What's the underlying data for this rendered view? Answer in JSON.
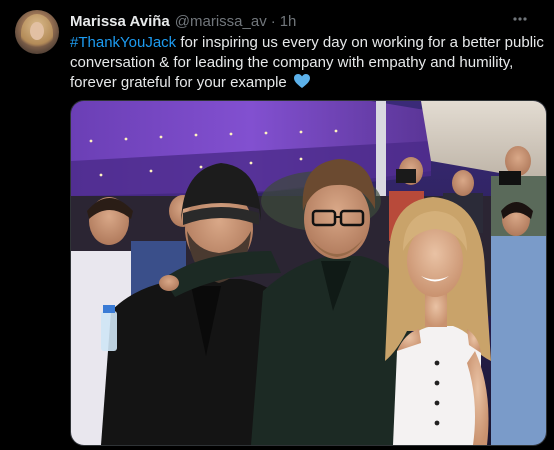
{
  "tweet": {
    "author_name": "Marissa Aviña",
    "author_handle": "@marissa_av",
    "separator": "·",
    "timestamp": "1h",
    "hashtag": "#ThankYouJack",
    "text": " for inspiring us every day on working for a better public conversation & for leading the company with empathy and humility, forever grateful for your example",
    "emoji": "blue-heart-icon",
    "more_icon": "more-options-icon",
    "media": {
      "type": "photo",
      "alt": ""
    }
  },
  "colors": {
    "background": "#000000",
    "text": "#e7e9ea",
    "secondary": "#71767b",
    "link": "#1d9bf0",
    "heart": "#5cb1ea"
  }
}
